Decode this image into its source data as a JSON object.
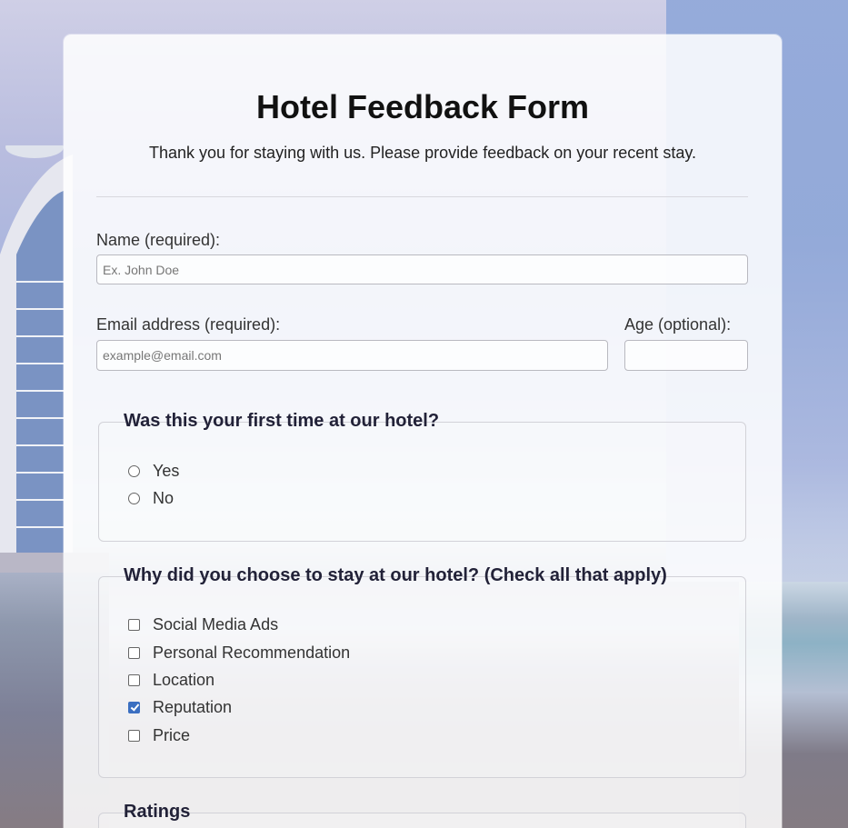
{
  "form": {
    "title": "Hotel Feedback Form",
    "subtitle": "Thank you for staying with us. Please provide feedback on your recent stay.",
    "name": {
      "label": "Name (required):",
      "placeholder": "Ex. John Doe",
      "value": ""
    },
    "email": {
      "label": "Email address (required):",
      "placeholder": "example@email.com",
      "value": ""
    },
    "age": {
      "label": "Age (optional):",
      "placeholder": "",
      "value": ""
    },
    "first_time": {
      "legend": "Was this your first time at our hotel?",
      "options": [
        {
          "label": "Yes",
          "selected": false
        },
        {
          "label": "No",
          "selected": false
        }
      ]
    },
    "reasons": {
      "legend": "Why did you choose to stay at our hotel? (Check all that apply)",
      "options": [
        {
          "label": "Social Media Ads",
          "checked": false
        },
        {
          "label": "Personal Recommendation",
          "checked": false
        },
        {
          "label": "Location",
          "checked": false
        },
        {
          "label": "Reputation",
          "checked": true
        },
        {
          "label": "Price",
          "checked": false
        }
      ]
    },
    "ratings": {
      "legend": "Ratings"
    }
  },
  "colors": {
    "accent": "#3b6fc1",
    "card": "#ffffff",
    "text": "#333333"
  }
}
